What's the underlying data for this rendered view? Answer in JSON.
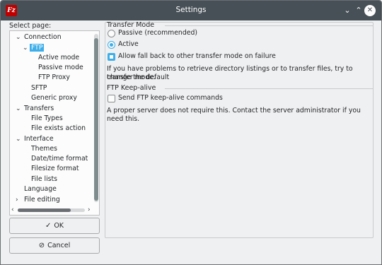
{
  "window": {
    "title": "Settings",
    "app_icon": "filezilla-icon",
    "controls": {
      "minimize": "⌄",
      "maximize": "⌃",
      "close": "✕"
    }
  },
  "sidebar": {
    "label": "Select page:",
    "tree": [
      {
        "label": "Connection",
        "expanded": true
      },
      {
        "label": "FTP",
        "expanded": true,
        "selected": true
      },
      {
        "label": "Active mode"
      },
      {
        "label": "Passive mode"
      },
      {
        "label": "FTP Proxy"
      },
      {
        "label": "SFTP"
      },
      {
        "label": "Generic proxy"
      },
      {
        "label": "Transfers",
        "expanded": true
      },
      {
        "label": "File Types"
      },
      {
        "label": "File exists action"
      },
      {
        "label": "Interface",
        "expanded": true
      },
      {
        "label": "Themes"
      },
      {
        "label": "Date/time format"
      },
      {
        "label": "Filesize format"
      },
      {
        "label": "File lists"
      },
      {
        "label": "Language"
      },
      {
        "label": "File editing",
        "expanded": false
      }
    ]
  },
  "buttons": {
    "ok": "OK",
    "cancel": "Cancel"
  },
  "transfer_mode": {
    "title": "Transfer Mode",
    "passive_label": "Passive (recommended)",
    "active_label": "Active",
    "selected": "Active",
    "fallback_label": "Allow fall back to other transfer mode on failure",
    "fallback_checked": true,
    "hint_line1": "If you have problems to retrieve directory listings or to transfer files, try to change the default",
    "hint_line2": "transfer mode."
  },
  "keep_alive": {
    "title": "FTP Keep-alive",
    "checkbox_label": "Send FTP keep-alive commands",
    "checked": false,
    "note": "A proper server does not require this. Contact the server administrator if you need this."
  },
  "colors": {
    "accent": "#3daee9",
    "titlebar": "#475057",
    "window_bg": "#eff0f1"
  }
}
